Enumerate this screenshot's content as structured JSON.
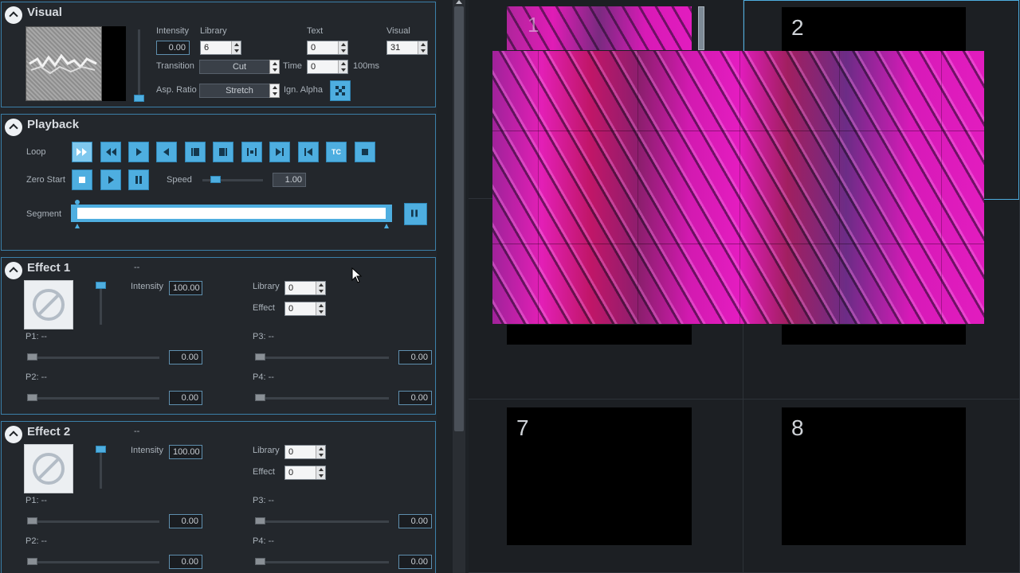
{
  "visual": {
    "title": "Visual",
    "intensity_label": "Intensity",
    "intensity_value": "0.00",
    "library_label": "Library",
    "library_value": "6",
    "text_label": "Text",
    "text_value": "0",
    "visual_label": "Visual",
    "visual_value": "31",
    "transition_label": "Transition",
    "transition_value": "Cut",
    "time_label": "Time",
    "time_value": "0",
    "time_unit": "100ms",
    "aspect_label": "Asp. Ratio",
    "aspect_value": "Stretch",
    "ign_alpha_label": "Ign. Alpha"
  },
  "playback": {
    "title": "Playback",
    "loop_label": "Loop",
    "zero_start_label": "Zero Start",
    "speed_label": "Speed",
    "speed_value": "1.00",
    "segment_label": "Segment",
    "tc_label": "TC"
  },
  "effect1": {
    "title": "Effect 1",
    "name": "--",
    "intensity_label": "Intensity",
    "intensity_value": "100.00",
    "library_label": "Library",
    "library_value": "0",
    "effect_label": "Effect",
    "effect_value": "0",
    "p1_label": "P1: --",
    "p1_value": "0.00",
    "p2_label": "P2: --",
    "p2_value": "0.00",
    "p3_label": "P3: --",
    "p3_value": "0.00",
    "p4_label": "P4: --",
    "p4_value": "0.00"
  },
  "effect2": {
    "title": "Effect 2",
    "name": "--",
    "intensity_label": "Intensity",
    "intensity_value": "100.00",
    "library_label": "Library",
    "library_value": "0",
    "effect_label": "Effect",
    "effect_value": "0",
    "p1_label": "P1: --",
    "p1_value": "0.00",
    "p2_label": "P2: --",
    "p2_value": "0.00",
    "p3_label": "P3: --",
    "p3_value": "0.00",
    "p4_label": "P4: --",
    "p4_value": "0.00"
  },
  "slots": {
    "slot1": "1",
    "slot2": "2",
    "slot7": "7",
    "slot8": "8"
  },
  "colors": {
    "accent": "#4eaee0",
    "panel_border": "#3b7fa8",
    "magenta": "#e21cbf"
  }
}
